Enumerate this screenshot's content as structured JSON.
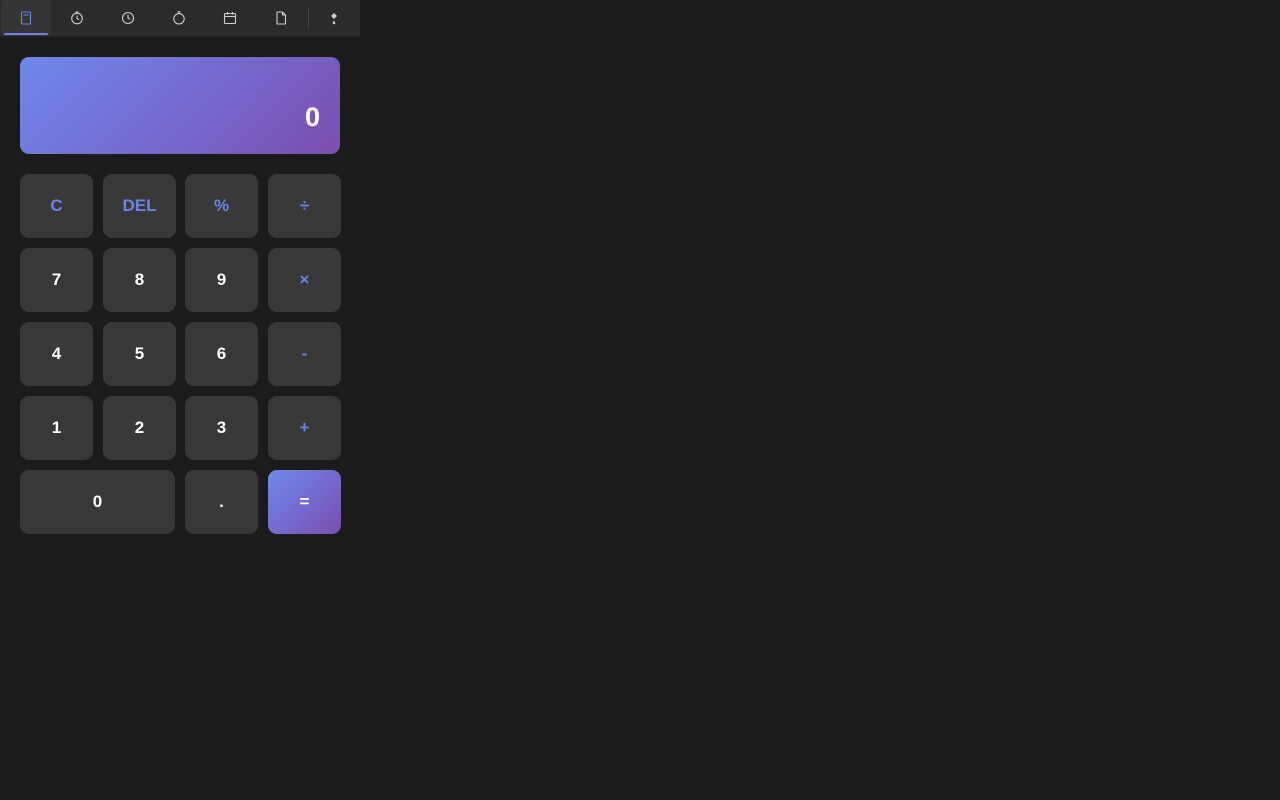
{
  "toolbar": {
    "tabs": [
      {
        "name": "calculator",
        "icon": "calculator-icon",
        "active": true
      },
      {
        "name": "timer",
        "icon": "timer-icon",
        "active": false
      },
      {
        "name": "clock",
        "icon": "clock-icon",
        "active": false
      },
      {
        "name": "stopwatch",
        "icon": "stopwatch-icon",
        "active": false
      },
      {
        "name": "calendar",
        "icon": "calendar-icon",
        "active": false
      },
      {
        "name": "notes",
        "icon": "document-icon",
        "active": false
      },
      {
        "name": "theme",
        "icon": "paint-bucket-icon",
        "active": false
      }
    ]
  },
  "display": {
    "value": "0"
  },
  "keys": {
    "clear": "C",
    "delete": "DEL",
    "percent": "%",
    "divide": "÷",
    "seven": "7",
    "eight": "8",
    "nine": "9",
    "multiply": "×",
    "four": "4",
    "five": "5",
    "six": "6",
    "subtract": "-",
    "one": "1",
    "two": "2",
    "three": "3",
    "add": "+",
    "zero": "0",
    "decimal": ".",
    "equals": "="
  },
  "colors": {
    "background": "#1b1b1b",
    "toolbar": "#2b2b2b",
    "key": "#383838",
    "accent": "#6b84ea",
    "gradient_start": "#6f87ee",
    "gradient_end": "#7a4fae"
  }
}
